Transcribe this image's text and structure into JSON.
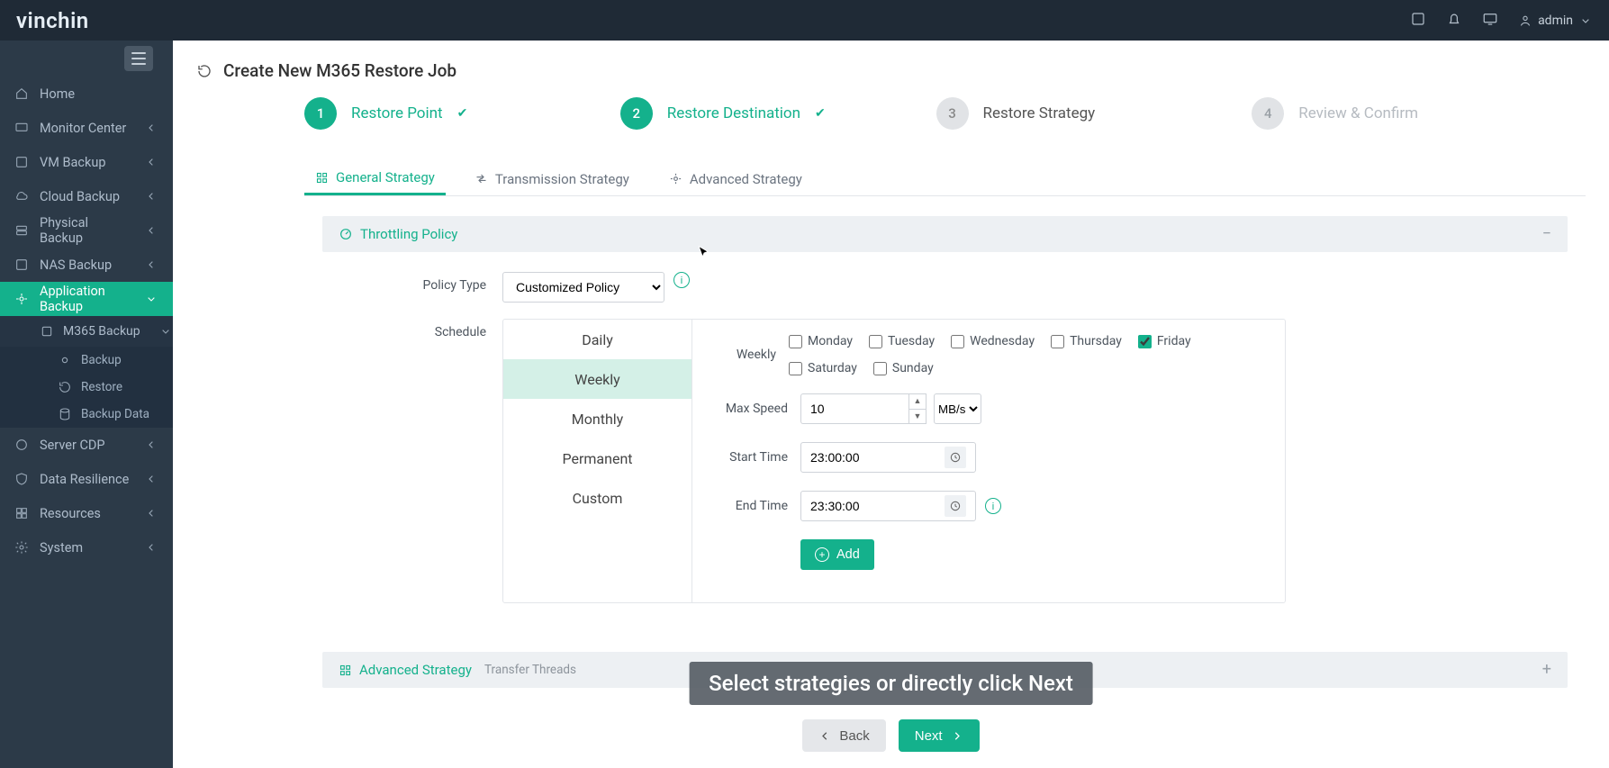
{
  "brand": "vinchin",
  "header_user": "admin",
  "sidebar": {
    "items": [
      {
        "label": "Home"
      },
      {
        "label": "Monitor Center",
        "expandable": true
      },
      {
        "label": "VM Backup",
        "expandable": true
      },
      {
        "label": "Cloud Backup",
        "expandable": true
      },
      {
        "label": "Physical Backup",
        "expandable": true
      },
      {
        "label": "NAS Backup",
        "expandable": true
      },
      {
        "label": "Application Backup",
        "expandable": true,
        "active": true
      },
      {
        "label": "Server CDP",
        "expandable": true
      },
      {
        "label": "Data Resilience",
        "expandable": true
      },
      {
        "label": "Resources",
        "expandable": true
      },
      {
        "label": "System",
        "expandable": true
      }
    ],
    "sub": {
      "label": "M365 Backup"
    },
    "subsub": [
      {
        "label": "Backup"
      },
      {
        "label": "Restore"
      },
      {
        "label": "Backup Data"
      }
    ]
  },
  "page_title": "Create New M365 Restore Job",
  "steps": [
    {
      "n": "1",
      "label": "Restore Point"
    },
    {
      "n": "2",
      "label": "Restore Destination"
    },
    {
      "n": "3",
      "label": "Restore Strategy"
    },
    {
      "n": "4",
      "label": "Review & Confirm"
    }
  ],
  "tabs": {
    "general": "General Strategy",
    "transmission": "Transmission Strategy",
    "advanced": "Advanced Strategy"
  },
  "throttling": {
    "title": "Throttling Policy",
    "policy_type_label": "Policy Type",
    "policy_type_value": "Customized Policy",
    "schedule_label": "Schedule",
    "schedule_tabs": [
      "Daily",
      "Weekly",
      "Monthly",
      "Permanent",
      "Custom"
    ],
    "weekly_label": "Weekly",
    "days": [
      "Monday",
      "Tuesday",
      "Wednesday",
      "Thursday",
      "Friday",
      "Saturday",
      "Sunday"
    ],
    "checked_day_index": 4,
    "max_speed_label": "Max Speed",
    "max_speed_value": "10",
    "unit": "MB/s",
    "start_label": "Start Time",
    "start_value": "23:00:00",
    "end_label": "End Time",
    "end_value": "23:30:00",
    "add_label": "Add"
  },
  "advanced_section": {
    "title": "Advanced Strategy",
    "subtitle": "Transfer Threads"
  },
  "footer": {
    "back": "Back",
    "next": "Next"
  },
  "hint": "Select strategies or directly click Next"
}
